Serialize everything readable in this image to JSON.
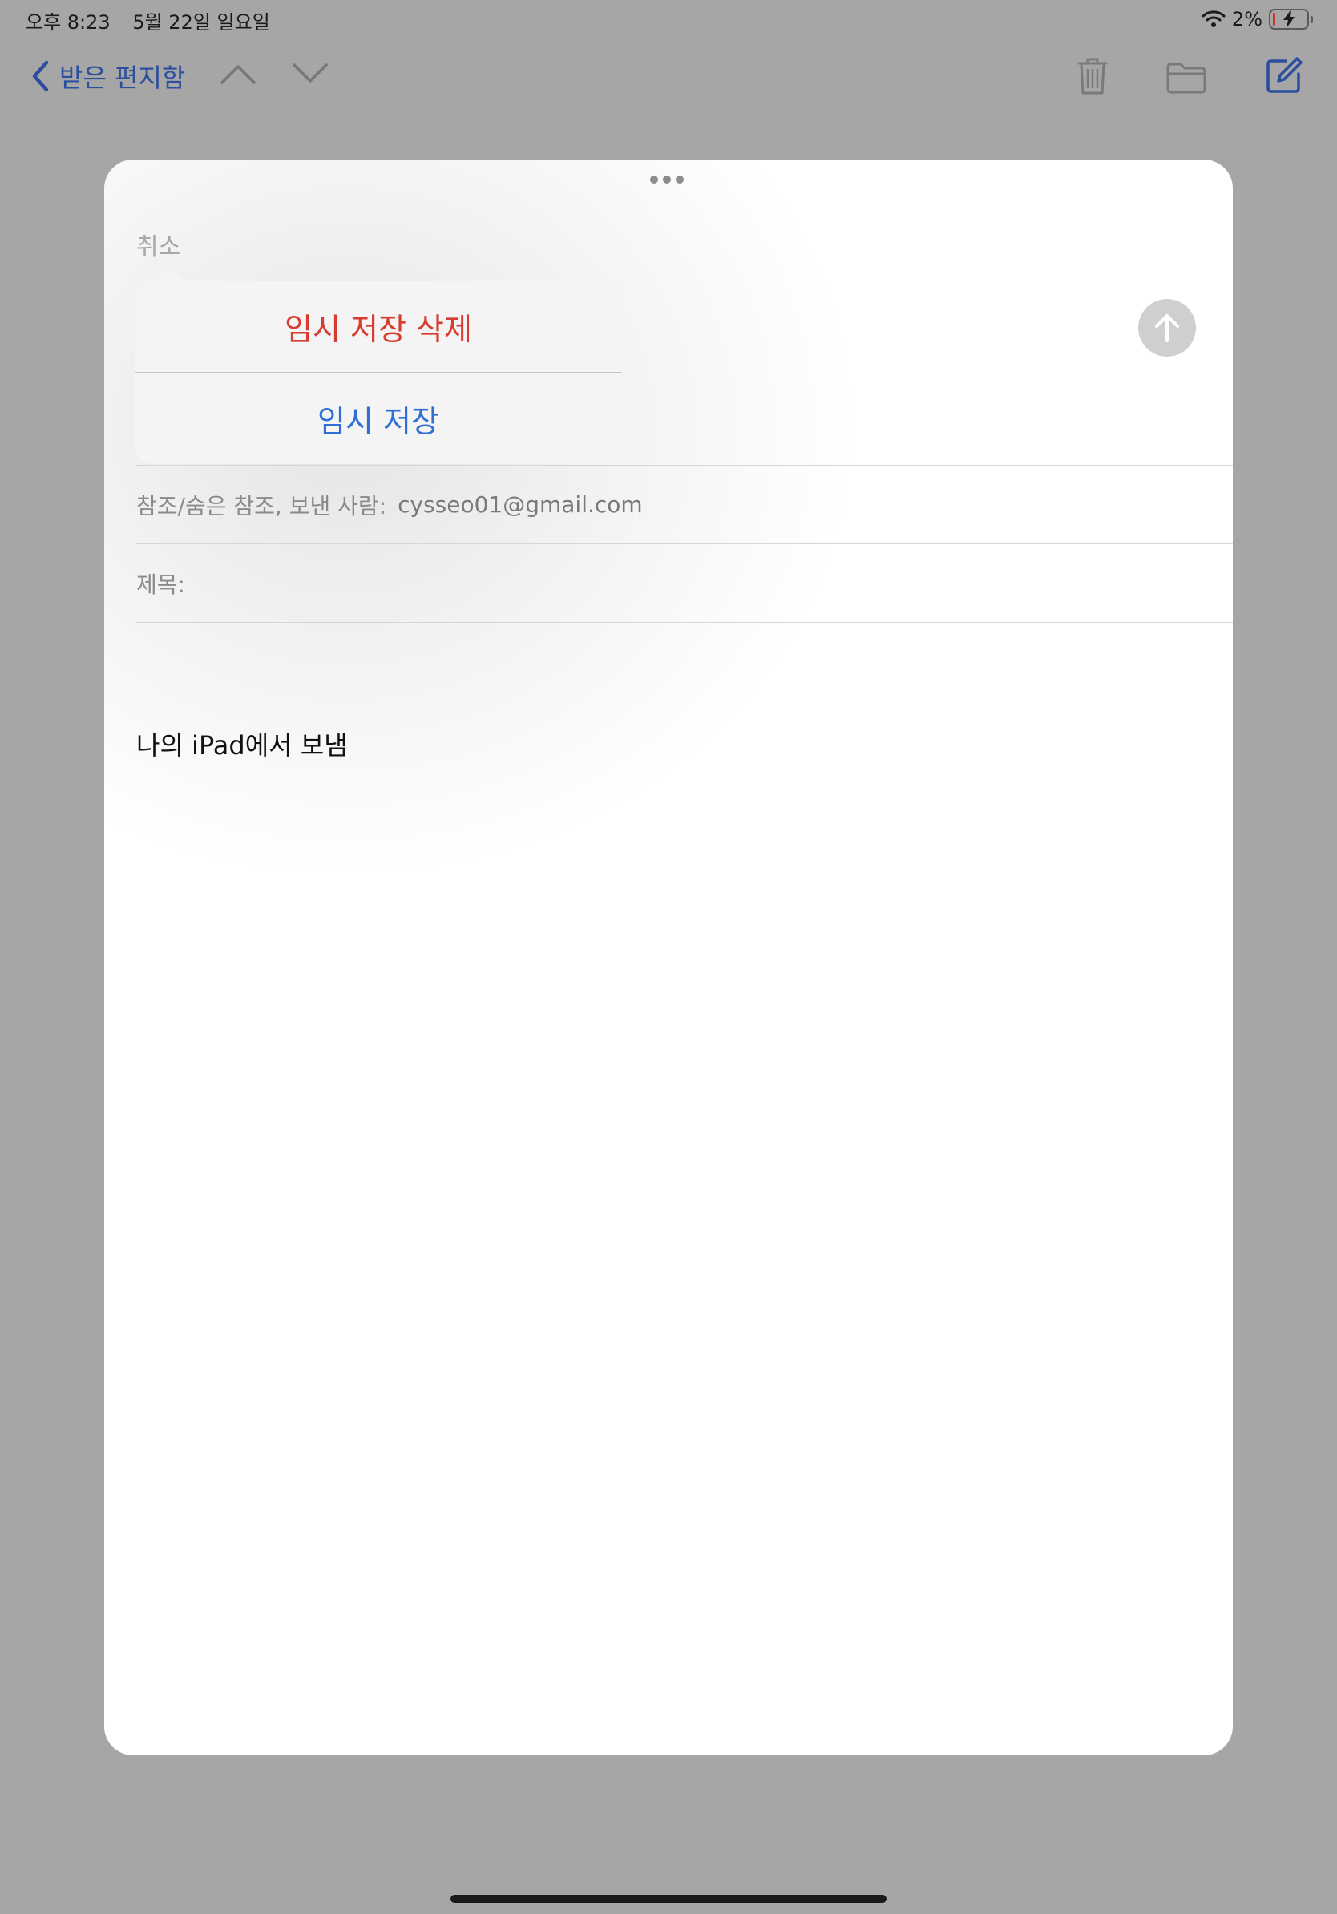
{
  "status_bar": {
    "time": "오후 8:23",
    "date": "5월 22일 일요일",
    "battery_percent": "2%",
    "battery_level": 0.02,
    "wifi_icon": "wifi-icon",
    "battery_icon": "battery-charging-icon"
  },
  "nav": {
    "back_label": "받은 편지함",
    "back_icon": "chevron-left-icon",
    "prev_icon": "chevron-up-icon",
    "next_icon": "chevron-down-icon",
    "trash_icon": "trash-icon",
    "folder_icon": "folder-icon",
    "compose_icon": "compose-icon"
  },
  "compose": {
    "cancel_label": "취소",
    "send_icon": "arrow-up-icon",
    "cc_bcc_from_label": "참조/숨은 참조, 보낸 사람:",
    "from_value": "cysseo01@gmail.com",
    "subject_label": "제목:",
    "subject_value": "",
    "body_signature": "나의 iPad에서 보냄"
  },
  "popover": {
    "delete_draft_label": "임시 저장 삭제",
    "save_draft_label": "임시 저장"
  },
  "colors": {
    "accent": "#2f6fd6",
    "destructive": "#d63d30",
    "nav_tint": "#2b4f9e"
  }
}
